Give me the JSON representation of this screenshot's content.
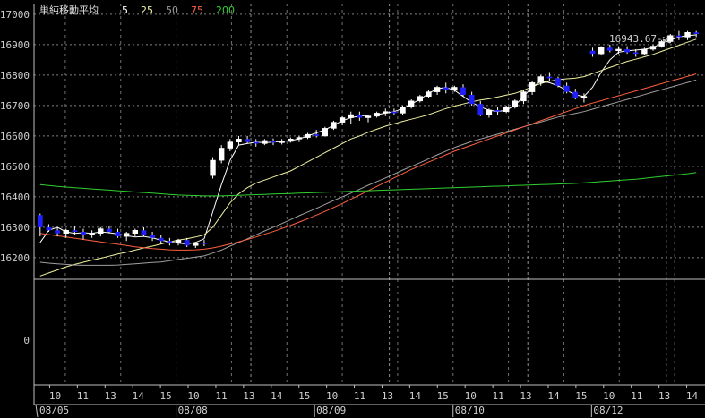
{
  "chart_data": {
    "type": "candlestick",
    "title": "単純移動平均",
    "legend": [
      {
        "label": "5",
        "color": "#ffffff"
      },
      {
        "label": "25",
        "color": "#f0f0a0"
      },
      {
        "label": "50",
        "color": "#a0a0a0"
      },
      {
        "label": "75",
        "color": "#ff6040"
      },
      {
        "label": "200",
        "color": "#30d030"
      }
    ],
    "y_ticks": [
      "17000",
      "16900",
      "16800",
      "16700",
      "16600",
      "16500",
      "16400",
      "16300",
      "16200"
    ],
    "ylim": [
      16135,
      17035
    ],
    "sub_y_tick": "0",
    "x_tick_labels": [
      "10",
      "11",
      "13",
      "14",
      "15",
      "10",
      "11",
      "13",
      "14",
      "15",
      "10",
      "11",
      "13",
      "14",
      "15",
      "10",
      "11",
      "13",
      "14",
      "15",
      "10",
      "11",
      "13",
      "14"
    ],
    "date_labels": [
      "08/05",
      "08/08",
      "08/09",
      "08/10",
      "08/12"
    ],
    "annotation": "16943.67->",
    "colors": {
      "up": "#ffffff",
      "down": "#2020ff",
      "grid": "#909090",
      "axis": "#c0c0c0"
    },
    "candles": [
      [
        16340,
        16345,
        16270,
        16300
      ],
      [
        16300,
        16310,
        16285,
        16290
      ],
      [
        16290,
        16300,
        16270,
        16280
      ],
      [
        16280,
        16295,
        16265,
        16290
      ],
      [
        16290,
        16305,
        16275,
        16285
      ],
      [
        16285,
        16295,
        16260,
        16275
      ],
      [
        16275,
        16290,
        16265,
        16280
      ],
      [
        16280,
        16300,
        16270,
        16295
      ],
      [
        16295,
        16305,
        16280,
        16285
      ],
      [
        16285,
        16295,
        16265,
        16270
      ],
      [
        16270,
        16285,
        16255,
        16280
      ],
      [
        16280,
        16295,
        16270,
        16290
      ],
      [
        16290,
        16300,
        16270,
        16275
      ],
      [
        16275,
        16285,
        16255,
        16265
      ],
      [
        16265,
        16275,
        16245,
        16255
      ],
      [
        16255,
        16265,
        16240,
        16250
      ],
      [
        16250,
        16262,
        16240,
        16258
      ],
      [
        16258,
        16265,
        16235,
        16240
      ],
      [
        16240,
        16252,
        16232,
        16248
      ],
      [
        16248,
        16258,
        16238,
        16245
      ],
      [
        16470,
        16530,
        16460,
        16520
      ],
      [
        16520,
        16570,
        16510,
        16560
      ],
      [
        16560,
        16590,
        16550,
        16580
      ],
      [
        16580,
        16600,
        16570,
        16590
      ],
      [
        16590,
        16600,
        16575,
        16580
      ],
      [
        16580,
        16590,
        16565,
        16575
      ],
      [
        16575,
        16590,
        16570,
        16585
      ],
      [
        16585,
        16592,
        16570,
        16578
      ],
      [
        16578,
        16590,
        16572,
        16582
      ],
      [
        16582,
        16595,
        16578,
        16590
      ],
      [
        16590,
        16600,
        16580,
        16595
      ],
      [
        16595,
        16610,
        16590,
        16605
      ],
      [
        16605,
        16620,
        16595,
        16600
      ],
      [
        16600,
        16630,
        16598,
        16625
      ],
      [
        16625,
        16650,
        16620,
        16645
      ],
      [
        16645,
        16665,
        16635,
        16660
      ],
      [
        16660,
        16680,
        16640,
        16670
      ],
      [
        16670,
        16680,
        16650,
        16660
      ],
      [
        16660,
        16670,
        16645,
        16665
      ],
      [
        16665,
        16680,
        16660,
        16675
      ],
      [
        16675,
        16690,
        16665,
        16680
      ],
      [
        16680,
        16690,
        16670,
        16675
      ],
      [
        16675,
        16700,
        16670,
        16695
      ],
      [
        16695,
        16720,
        16690,
        16715
      ],
      [
        16715,
        16735,
        16710,
        16730
      ],
      [
        16730,
        16750,
        16725,
        16745
      ],
      [
        16745,
        16765,
        16735,
        16760
      ],
      [
        16760,
        16775,
        16740,
        16750
      ],
      [
        16750,
        16765,
        16745,
        16760
      ],
      [
        16760,
        16770,
        16730,
        16735
      ],
      [
        16735,
        16745,
        16700,
        16705
      ],
      [
        16705,
        16715,
        16665,
        16670
      ],
      [
        16670,
        16690,
        16660,
        16685
      ],
      [
        16685,
        16695,
        16670,
        16680
      ],
      [
        16680,
        16700,
        16675,
        16695
      ],
      [
        16695,
        16720,
        16690,
        16715
      ],
      [
        16715,
        16750,
        16705,
        16745
      ],
      [
        16745,
        16780,
        16735,
        16775
      ],
      [
        16775,
        16800,
        16765,
        16795
      ],
      [
        16795,
        16810,
        16780,
        16790
      ],
      [
        16790,
        16795,
        16760,
        16765
      ],
      [
        16765,
        16775,
        16740,
        16745
      ],
      [
        16745,
        16755,
        16720,
        16725
      ],
      [
        16725,
        16740,
        16710,
        16730
      ],
      [
        16880,
        16890,
        16860,
        16870
      ],
      [
        16870,
        16895,
        16865,
        16890
      ],
      [
        16890,
        16900,
        16875,
        16880
      ],
      [
        16880,
        16895,
        16870,
        16885
      ],
      [
        16885,
        16895,
        16870,
        16875
      ],
      [
        16875,
        16885,
        16860,
        16870
      ],
      [
        16870,
        16890,
        16865,
        16885
      ],
      [
        16885,
        16900,
        16880,
        16895
      ],
      [
        16895,
        16915,
        16890,
        16910
      ],
      [
        16910,
        16935,
        16905,
        16930
      ],
      [
        16930,
        16945,
        16915,
        16925
      ],
      [
        16925,
        16945,
        16915,
        16940
      ],
      [
        16940,
        16945,
        16925,
        16935
      ]
    ],
    "ma": {
      "5": [
        16250,
        16290,
        16300,
        16285,
        16280,
        16282,
        16280,
        16285,
        16282,
        16278,
        16272,
        16268,
        16270,
        16265,
        16258,
        16252,
        16248,
        16245,
        16250,
        16262,
        16350,
        16440,
        16520,
        16570,
        16575,
        16580,
        16578,
        16580,
        16582,
        16585,
        16590,
        16600,
        16610,
        16620,
        16635,
        16650,
        16660,
        16665,
        16668,
        16670,
        16675,
        16680,
        16690,
        16705,
        16720,
        16740,
        16755,
        16760,
        16750,
        16730,
        16710,
        16695,
        16685,
        16680,
        16685,
        16700,
        16730,
        16760,
        16780,
        16775,
        16765,
        16750,
        16735,
        16730,
        16760,
        16810,
        16850,
        16875,
        16880,
        16882,
        16885,
        16890,
        16905,
        16915,
        16925,
        16930,
        16932
      ],
      "25": [
        16140,
        16150,
        16160,
        16170,
        16178,
        16185,
        16192,
        16198,
        16205,
        16212,
        16218,
        16225,
        16232,
        16238,
        16245,
        16252,
        16258,
        16262,
        16268,
        16275,
        16300,
        16340,
        16380,
        16410,
        16430,
        16445,
        16455,
        16465,
        16475,
        16485,
        16500,
        16515,
        16530,
        16545,
        16560,
        16575,
        16590,
        16600,
        16612,
        16622,
        16632,
        16640,
        16648,
        16655,
        16662,
        16670,
        16680,
        16690,
        16698,
        16705,
        16712,
        16718,
        16722,
        16728,
        16734,
        16740,
        16750,
        16762,
        16772,
        16780,
        16785,
        16788,
        16790,
        16795,
        16805,
        16815,
        16825,
        16835,
        16845,
        16852,
        16860,
        16868,
        16878,
        16888,
        16898,
        16908,
        16918
      ],
      "50": [
        16185,
        16182,
        16180,
        16178,
        16176,
        16175,
        16175,
        16175,
        16175,
        16176,
        16178,
        16180,
        16182,
        16184,
        16186,
        16190,
        16194,
        16198,
        16202,
        16206,
        16215,
        16225,
        16238,
        16250,
        16262,
        16275,
        16288,
        16300,
        16312,
        16325,
        16338,
        16350,
        16362,
        16375,
        16388,
        16400,
        16412,
        16425,
        16438,
        16450,
        16462,
        16475,
        16488,
        16500,
        16512,
        16525,
        16538,
        16550,
        16562,
        16572,
        16582,
        16590,
        16598,
        16606,
        16614,
        16622,
        16630,
        16638,
        16646,
        16654,
        16662,
        16668,
        16674,
        16680,
        16688,
        16696,
        16704,
        16712,
        16720,
        16728,
        16736,
        16744,
        16752,
        16760,
        16768,
        16776,
        16784
      ],
      "75": [
        16280,
        16276,
        16272,
        16268,
        16264,
        16260,
        16256,
        16252,
        16248,
        16244,
        16240,
        16236,
        16233,
        16230,
        16228,
        16226,
        16225,
        16225,
        16226,
        16228,
        16232,
        16238,
        16245,
        16252,
        16260,
        16268,
        16277,
        16286,
        16296,
        16306,
        16317,
        16328,
        16340,
        16352,
        16365,
        16378,
        16392,
        16406,
        16420,
        16434,
        16448,
        16462,
        16476,
        16490,
        16502,
        16514,
        16526,
        16538,
        16550,
        16560,
        16570,
        16580,
        16590,
        16600,
        16610,
        16620,
        16630,
        16640,
        16650,
        16660,
        16670,
        16680,
        16690,
        16700,
        16708,
        16716,
        16724,
        16732,
        16740,
        16748,
        16756,
        16764,
        16772,
        16780,
        16788,
        16796,
        16804
      ],
      "200": [
        16440,
        16437,
        16434,
        16432,
        16430,
        16428,
        16426,
        16424,
        16422,
        16420,
        16418,
        16416,
        16414,
        16412,
        16410,
        16408,
        16406,
        16405,
        16404,
        16403,
        16403,
        16403,
        16404,
        16405,
        16406,
        16407,
        16408,
        16409,
        16410,
        16411,
        16412,
        16413,
        16414,
        16415,
        16416,
        16417,
        16418,
        16419,
        16420,
        16421,
        16422,
        16423,
        16424,
        16425,
        16426,
        16427,
        16428,
        16429,
        16430,
        16431,
        16432,
        16433,
        16434,
        16435,
        16436,
        16437,
        16438,
        16439,
        16440,
        16441,
        16442,
        16443,
        16444,
        16446,
        16448,
        16450,
        16452,
        16454,
        16456,
        16458,
        16461,
        16464,
        16467,
        16470,
        16473,
        16476,
        16480
      ]
    }
  }
}
